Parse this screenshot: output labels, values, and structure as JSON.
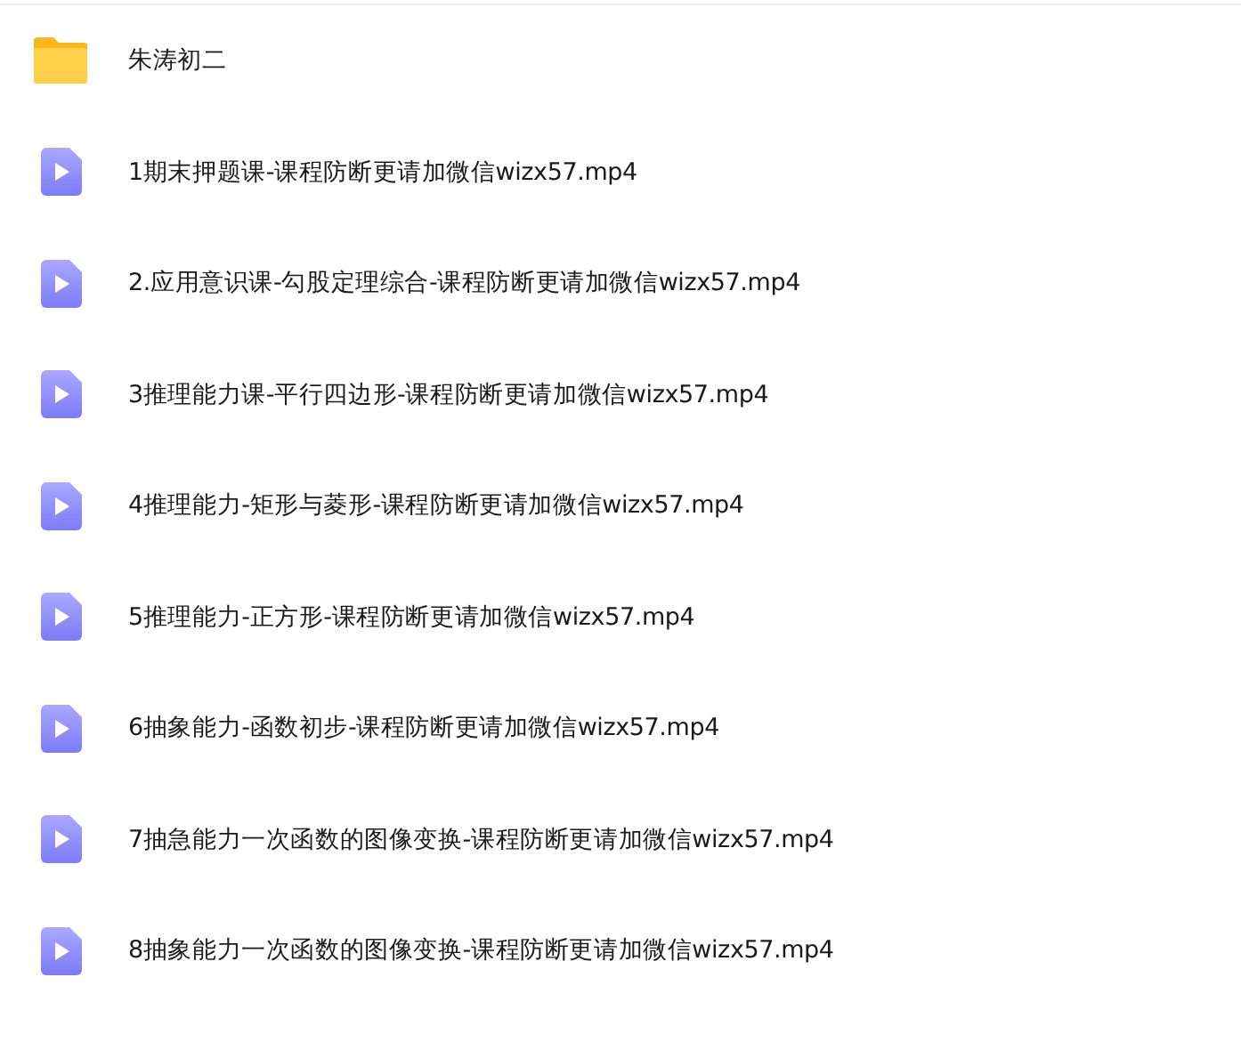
{
  "files": [
    {
      "kind": "folder",
      "name": "朱涛初二"
    },
    {
      "kind": "video",
      "name": "1期末押题课-课程防断更请加微信wizx57.mp4"
    },
    {
      "kind": "video",
      "name": "2.应用意识课-勾股定理综合-课程防断更请加微信wizx57.mp4"
    },
    {
      "kind": "video",
      "name": "3推理能力课-平行四边形-课程防断更请加微信wizx57.mp4"
    },
    {
      "kind": "video",
      "name": "4推理能力-矩形与菱形-课程防断更请加微信wizx57.mp4"
    },
    {
      "kind": "video",
      "name": "5推理能力-正方形-课程防断更请加微信wizx57.mp4"
    },
    {
      "kind": "video",
      "name": "6抽象能力-函数初步-课程防断更请加微信wizx57.mp4"
    },
    {
      "kind": "video",
      "name": "7抽急能力一次函数的图像变换-课程防断更请加微信wizx57.mp4"
    },
    {
      "kind": "video",
      "name": "8抽象能力一次函数的图像变换-课程防断更请加微信wizx57.mp4"
    }
  ]
}
